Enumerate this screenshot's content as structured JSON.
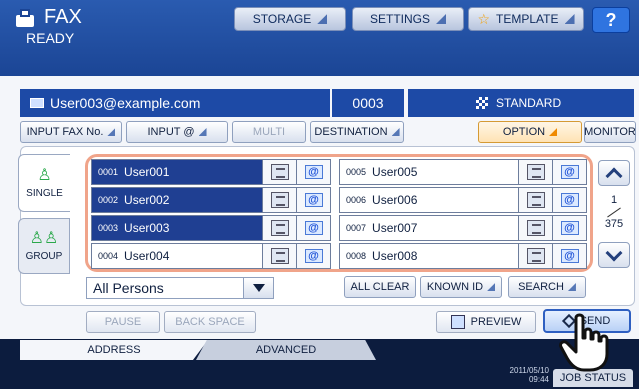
{
  "header": {
    "app_title": "FAX",
    "status": "READY",
    "storage_label": "STORAGE",
    "settings_label": "SETTINGS",
    "template_label": "TEMPLATE",
    "help_label": "?"
  },
  "info": {
    "recipient": "User003@example.com",
    "count": "0003",
    "resolution": "STANDARD"
  },
  "options": {
    "input_fax_no": "INPUT FAX No.",
    "input_at": "INPUT @",
    "multi": "MULTI",
    "destination": "DESTINATION",
    "option": "OPTION",
    "monitor": "MONITOR"
  },
  "tabs": {
    "single": "SINGLE",
    "group": "GROUP"
  },
  "entries": [
    {
      "num": "0001",
      "name": "User001",
      "selected": true
    },
    {
      "num": "0002",
      "name": "User002",
      "selected": true
    },
    {
      "num": "0003",
      "name": "User003",
      "selected": true
    },
    {
      "num": "0004",
      "name": "User004",
      "selected": false
    },
    {
      "num": "0005",
      "name": "User005",
      "selected": false
    },
    {
      "num": "0006",
      "name": "User006",
      "selected": false
    },
    {
      "num": "0007",
      "name": "User007",
      "selected": false
    },
    {
      "num": "0008",
      "name": "User008",
      "selected": false
    }
  ],
  "pager": {
    "current": "1",
    "total": "375"
  },
  "filter": {
    "selected": "All Persons",
    "all_clear": "ALL CLEAR",
    "known_id": "KNOWN ID",
    "search": "SEARCH"
  },
  "actions": {
    "pause": "PAUSE",
    "back_space": "BACK SPACE",
    "preview": "PREVIEW",
    "send": "SEND"
  },
  "footer": {
    "tab_address": "ADDRESS",
    "tab_advanced": "ADVANCED",
    "date": "2011/05/10",
    "time": "09:44",
    "job_status": "JOB STATUS"
  }
}
